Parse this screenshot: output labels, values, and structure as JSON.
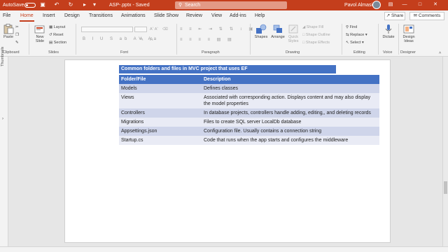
{
  "titlebar": {
    "autosave_label": "AutoSave",
    "toggle_state": "Off",
    "doc_title": "ASP-.pptx - Saved",
    "search_placeholder": "Search",
    "user_name": "Pavol Almasi",
    "accent_color": "#c43e1c"
  },
  "tabs": [
    "File",
    "Home",
    "Insert",
    "Design",
    "Transitions",
    "Animations",
    "Slide Show",
    "Review",
    "View",
    "Add-ins",
    "Help"
  ],
  "active_tab": "Home",
  "share_label": "Share",
  "comments_label": "Comments",
  "ribbon": {
    "clipboard": {
      "paste": "Paste",
      "label": "Clipboard"
    },
    "slides": {
      "new_slide": "New Slide",
      "layout": "Layout",
      "reset": "Reset",
      "section": "Section",
      "label": "Slides"
    },
    "font": {
      "label": "Font"
    },
    "paragraph": {
      "label": "Paragraph"
    },
    "drawing": {
      "shapes": "Shapes",
      "arrange": "Arrange",
      "quick_styles": "Quick Styles",
      "shape_fill": "Shape Fill",
      "shape_outline": "Shape Outline",
      "shape_effects": "Shape Effects",
      "label": "Drawing"
    },
    "editing": {
      "find": "Find",
      "replace": "Replace",
      "select": "Select",
      "label": "Editing"
    },
    "voice": {
      "dictate": "Dictate",
      "label": "Voice"
    },
    "designer": {
      "design_ideas": "Design Ideas",
      "label": "Designer"
    }
  },
  "thumbnails_label": "Thumbnails",
  "slide": {
    "title": "Common folders and files in MVC project that uses EF",
    "table": {
      "headers": [
        "Folder/File",
        "Description"
      ],
      "rows": [
        [
          "Models",
          "Defines classes"
        ],
        [
          "Views",
          "Associated with corresponding action. Displays content and may also display the model properties"
        ],
        [
          "Controllers",
          "In database projects, controllers handle adding, editing,, and deleting records"
        ],
        [
          "Migrations",
          "Files to create SQL server LocalDb database"
        ],
        [
          "Appsettings.json",
          "Configuration file. Usually contains a connection string"
        ],
        [
          "Startup.cs",
          "Code that runs when the app starts and configures the middleware"
        ]
      ]
    }
  },
  "table_colors": {
    "header": "#4472c4",
    "odd_row": "#cfd5ea",
    "even_row": "#e9ebf5"
  }
}
